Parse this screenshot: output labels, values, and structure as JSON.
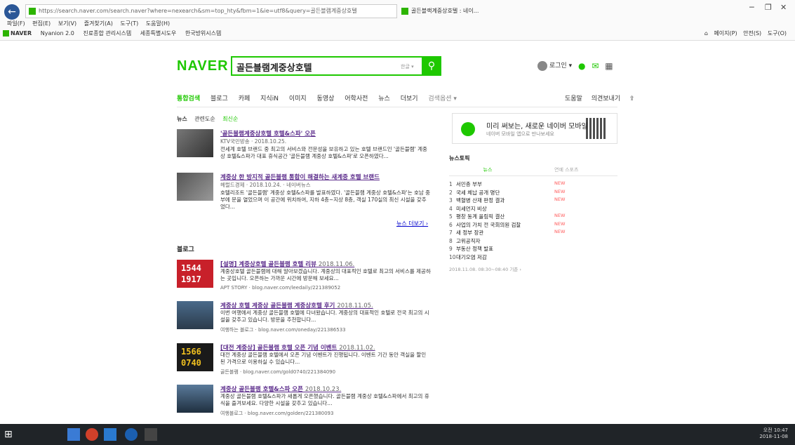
{
  "browser": {
    "address": "https://search.naver.com/search.naver?where=nexearch&sm=top_hty&fbm=1&ie=utf8&query=골든블램계중상호텔",
    "tab_title": "골든블랙계중상호텔 : 네이...",
    "menu": [
      "파일(F)",
      "편집(E)",
      "보기(V)",
      "즐겨찾기(A)",
      "도구(T)",
      "도움말(H)"
    ],
    "favorites": [
      "NAVER",
      "Nyanion 2.0",
      "진료종합 관리시스템",
      "세종특별시도우",
      "한국방위시스템"
    ],
    "commands": [
      "페이지(P)",
      "안전(S)",
      "도구(O)"
    ]
  },
  "naver": {
    "logo": "NAVER",
    "query": "골든블램계중상호텔",
    "kbd_hint": "한글 ▾",
    "user": "로그인 ▾",
    "nav": [
      "통합검색",
      "블로그",
      "카페",
      "지식iN",
      "이미지",
      "동영상",
      "어학사전",
      "뉴스",
      "더보기",
      "검색옵션 ▾"
    ],
    "nav_right": [
      "도움말",
      "의견보내기"
    ],
    "news_tabs": [
      "뉴스",
      "관련도순",
      "최신순"
    ],
    "news": [
      {
        "title": "'골든블램계중상호텔 호텔&스파' 오픈",
        "meta": "KTV국민방송 · 2018.10.25.",
        "desc": "전세계 호텔 브랜드 중 최고의 서비스와 전문성을 보유하고 있는 호텔 브랜드인 '골든블램' 계중상 호텔&스파가 대표 휴식공간 '골든블램 계중상 호텔&스파'로 오픈하였다..."
      },
      {
        "title": "계중상 한 방지적 골든블램 통합이 해결하는 새계중 호텔 브랜드",
        "meta": "헤럴드경제 · 2018.10.24. · 네이버뉴스",
        "desc": "호텔리조트 '골든블램' 계중상 호텔&스파를 발표하였다. '골든블램 계중상 호텔&스파'는 호남 중부에 문을 열었으며 이 공간에 위치하여, 지하 4층~지상 8층, 객실 170실의 최신 시설을 갖추었다..."
      }
    ],
    "news_more": "뉴스 더보기 ›",
    "blog_section": "블로그",
    "blogs": [
      {
        "title": "[설명] 계중상호텔 골든블램 호텔 리뷰",
        "date": "2018.11.06.",
        "desc": "계중상호텔 골든블램에 대해 알아보겠습니다. 계중상의 대표적인 호텔로 최고의 서비스를 제공하는 곳입니다. 오픈하는 가까운 시간에 방문해 보세요...",
        "meta": "APT STORY · blog.naver.com/leedaily/221389052",
        "thumb": "1544\n1917"
      },
      {
        "title": "계중상 호텔 계중상 골든블램 계중상호텔 후기",
        "date": "2018.11.05.",
        "desc": "이번 여행에서 계중상 골든블램 호텔에 다녀왔습니다. 계중상의 대표적인 호텔로 전국 최고의 시설을 갖추고 있습니다. 방문을 추천합니다...",
        "meta": "여행하는 블로그 · blog.naver.com/oneday/221386533",
        "thumb": ""
      },
      {
        "title": "[대전 계중상] 골든블램 호텔 오픈 기념 이벤트",
        "date": "2018.11.02.",
        "desc": "대전 계중상 골든블램 호텔에서 오픈 기념 이벤트가 진행됩니다. 이벤트 기간 동안 객실을 할인된 가격으로 이용하실 수 있습니다...",
        "meta": "골든블램 · blog.naver.com/gold0740/221384090",
        "thumb": "1566\n0740"
      },
      {
        "title": "계중상 골든블램 호텔&스파 오픈",
        "date": "2018.10.23.",
        "desc": "계중상 골든블램 호텔&스파가 새롭게 오픈했습니다. 골든블램 계중상 호텔&스파에서 최고의 휴식을 즐겨보세요. 다양한 시설을 갖추고 있습니다...",
        "meta": "여행블로그 · blog.naver.com/golden/221380093",
        "thumb": ""
      }
    ],
    "promo_title": "미리 써보는, 새로운 네이버 모바일",
    "promo_sub": "네이버 모바일 앱으로 만나보세요",
    "rank_title": "뉴스토픽",
    "rank_tabs": [
      "뉴스",
      "연예 스포츠"
    ],
    "rank": [
      {
        "n": "1",
        "t": "서민층 부부",
        "new": true
      },
      {
        "n": "2",
        "t": "국세 체납 공개 명단",
        "new": true
      },
      {
        "n": "3",
        "t": "백혈병 산재 판정 결과",
        "new": true
      },
      {
        "n": "4",
        "t": "미세먼지 비상",
        "new": false
      },
      {
        "n": "5",
        "t": "평창 동계 올림픽 결산",
        "new": true
      },
      {
        "n": "6",
        "t": "사업의 가치 전 국회의원 검찰",
        "new": true
      },
      {
        "n": "7",
        "t": "새 정부 장관",
        "new": true
      },
      {
        "n": "8",
        "t": "고위공직자",
        "new": false
      },
      {
        "n": "9",
        "t": "부동산 정책 발표",
        "new": false
      },
      {
        "n": "10",
        "t": "대기오염 저감",
        "new": false
      }
    ],
    "rank_foot": "2018.11.08. 08:30~08:40 기준 ›"
  },
  "taskbar": {
    "time": "오전 10:47",
    "date": "2018-11-08"
  }
}
